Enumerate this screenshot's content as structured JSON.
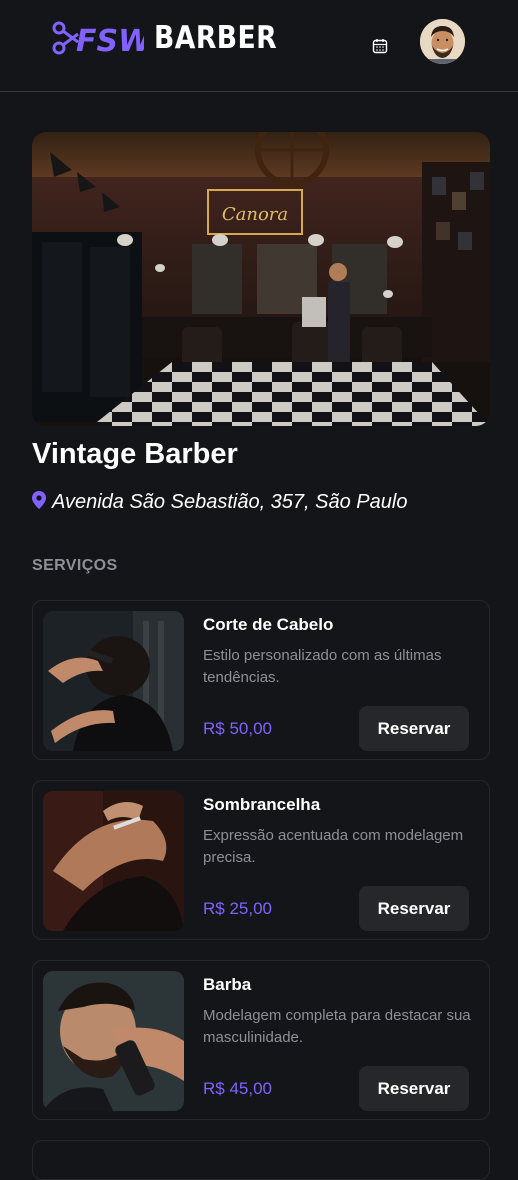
{
  "header": {
    "logo_text": "BARBER",
    "logo_mark_text": "FSW"
  },
  "shop": {
    "name": "Vintage Barber",
    "address": "Avenida São Sebastião, 357, São Paulo",
    "sign_text": "Canora"
  },
  "services": {
    "section_title": "SERVIÇOS",
    "items": [
      {
        "title": "Corte de Cabelo",
        "description": "Estilo personalizado com as últimas tendências.",
        "price": "R$ 50,00",
        "button_label": "Reservar"
      },
      {
        "title": "Sombrancelha",
        "description": "Expressão acentuada com modelagem precisa.",
        "price": "R$ 25,00",
        "button_label": "Reservar"
      },
      {
        "title": "Barba",
        "description": "Modelagem completa para destacar sua masculinidade.",
        "price": "R$ 45,00",
        "button_label": "Reservar"
      }
    ]
  },
  "colors": {
    "background": "#141518",
    "accent": "#8162ff",
    "muted_text": "#8f9097",
    "card_border": "#26272b",
    "button_bg": "#26272b"
  },
  "icons": [
    "scissors-icon",
    "calendar-icon",
    "map-pin-icon"
  ]
}
